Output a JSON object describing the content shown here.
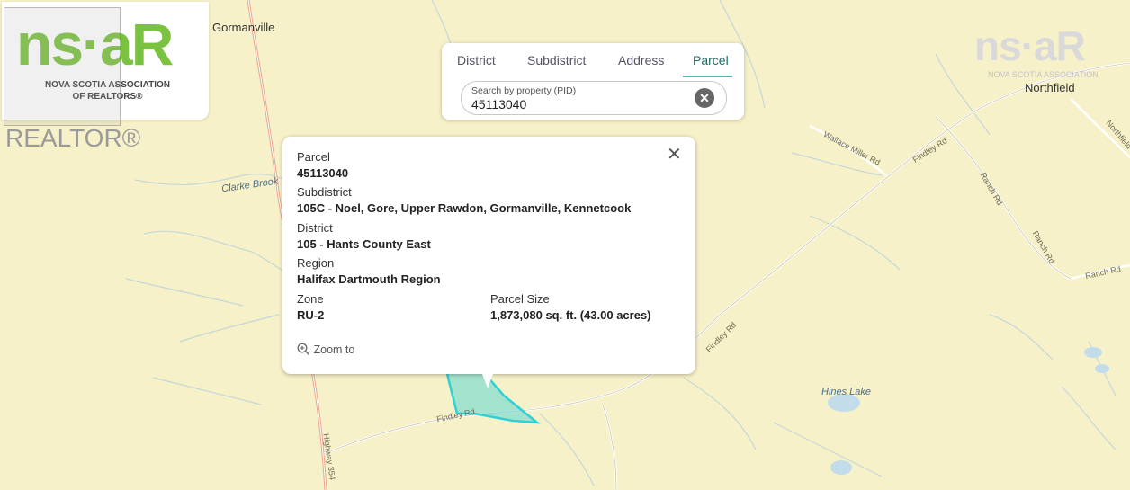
{
  "map": {
    "places": [
      "Gormanville",
      "Northfield"
    ],
    "roads": [
      "Findley Rd",
      "Findley Rd",
      "Wallace Miller Rd",
      "Ranch Rd",
      "Ranch Rd",
      "Ranch Rd",
      "Northfield Rd",
      "Highway 354",
      "Findley Rd"
    ],
    "water": [
      "Clarke Brook",
      "Hines Lake"
    ]
  },
  "logo": {
    "ns_text": "ns·aR",
    "assoc_line1": "NOVA SCOTIA ASSOCIATION",
    "assoc_line2": "OF REALTORS®",
    "realtor": "REALTOR®",
    "watermark_ns": "ns·aR",
    "watermark_assoc": "NOVA SCOTIA ASSOCIATION"
  },
  "search": {
    "tabs": [
      "District",
      "Subdistrict",
      "Address",
      "Parcel"
    ],
    "active_tab": "Parcel",
    "placeholder": "Search by property (PID)",
    "value": "45113040"
  },
  "popup": {
    "parcel_label": "Parcel",
    "parcel_value": "45113040",
    "subdistrict_label": "Subdistrict",
    "subdistrict_value": "105C - Noel, Gore, Upper Rawdon, Gormanville, Kennetcook",
    "district_label": "District",
    "district_value": "105 - Hants County East",
    "region_label": "Region",
    "region_value": "Halifax Dartmouth Region",
    "zone_label": "Zone",
    "zone_value": "RU-2",
    "size_label": "Parcel Size",
    "size_value": "1,873,080 sq. ft. (43.00 acres)",
    "zoom_label": "Zoom to"
  },
  "colors": {
    "map_bg": "#f7f1c9",
    "parcel_fill": "#5fd6cf",
    "accent": "#7cc242",
    "tab_active": "#4db8a8"
  }
}
